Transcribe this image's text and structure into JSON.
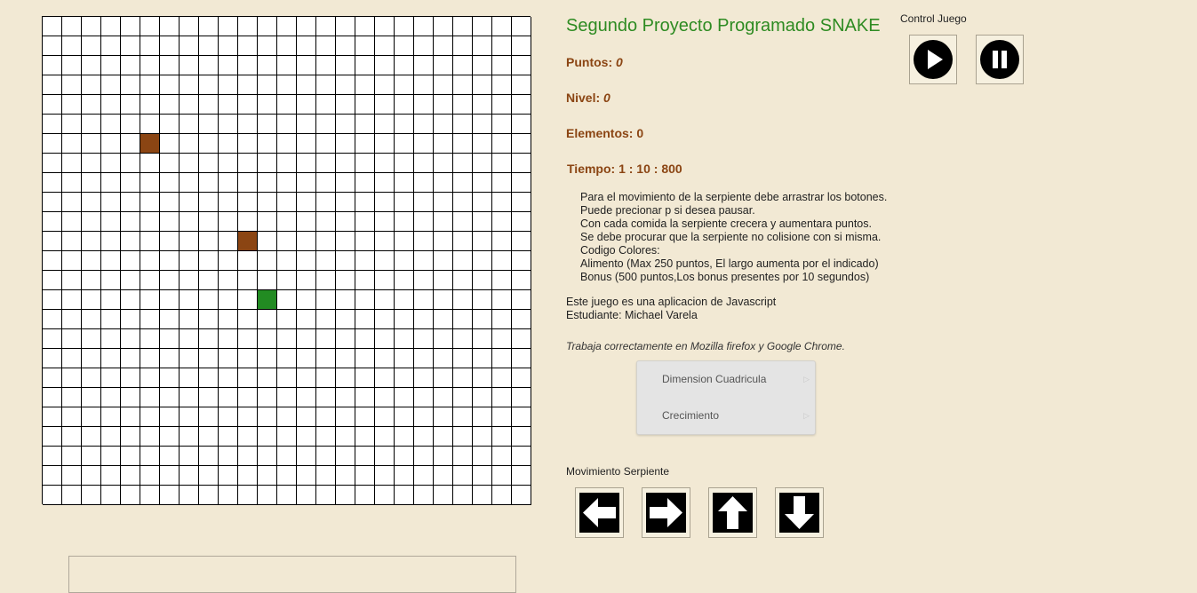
{
  "game": {
    "title": "Segundo Proyecto Programado SNAKE",
    "board": {
      "cols": 25,
      "rows": 25,
      "food": [
        [
          5,
          6
        ],
        [
          10,
          11
        ]
      ],
      "snake": [
        [
          11,
          14
        ]
      ]
    }
  },
  "stats": {
    "points_label": "Puntos: ",
    "points_value": "0",
    "level_label": "Nivel: ",
    "level_value": "0",
    "elements_label": "Elementos: ",
    "elements_value": "0",
    "time_label": "Tiempo: ",
    "time_value": "1 : 10 : 800"
  },
  "controls": {
    "label": "Control Juego",
    "play_icon": "play-icon",
    "pause_icon": "pause-icon"
  },
  "instructions": [
    "Para el movimiento de la serpiente debe arrastrar los botones.",
    "Puede precionar p si desea pausar.",
    "Con cada comida la serpiente crecera y aumentara puntos.",
    "Se debe procurar que la serpiente no colisione con si misma.",
    "Codigo Colores:",
    "Alimento (Max 250 puntos, El largo aumenta por el indicado)",
    "Bonus (500 puntos,Los bonus presentes por 10 segundos)"
  ],
  "about": [
    "Este juego es una aplicacion de Javascript",
    "Estudiante: Michael Varela"
  ],
  "browsers_note": "Trabaja correctamente en Mozilla firefox y Google Chrome.",
  "menu": {
    "items": [
      "Dimension Cuadricula",
      "Crecimiento"
    ]
  },
  "movement": {
    "label": "Movimiento Serpiente",
    "icons": [
      "arrow-left-icon",
      "arrow-right-icon",
      "arrow-up-icon",
      "arrow-down-icon"
    ]
  },
  "colors": {
    "background": "#f2e9d4",
    "title": "#2e8b22",
    "stats": "#8b4513",
    "food": "#8b4513",
    "snake": "#228b22"
  }
}
